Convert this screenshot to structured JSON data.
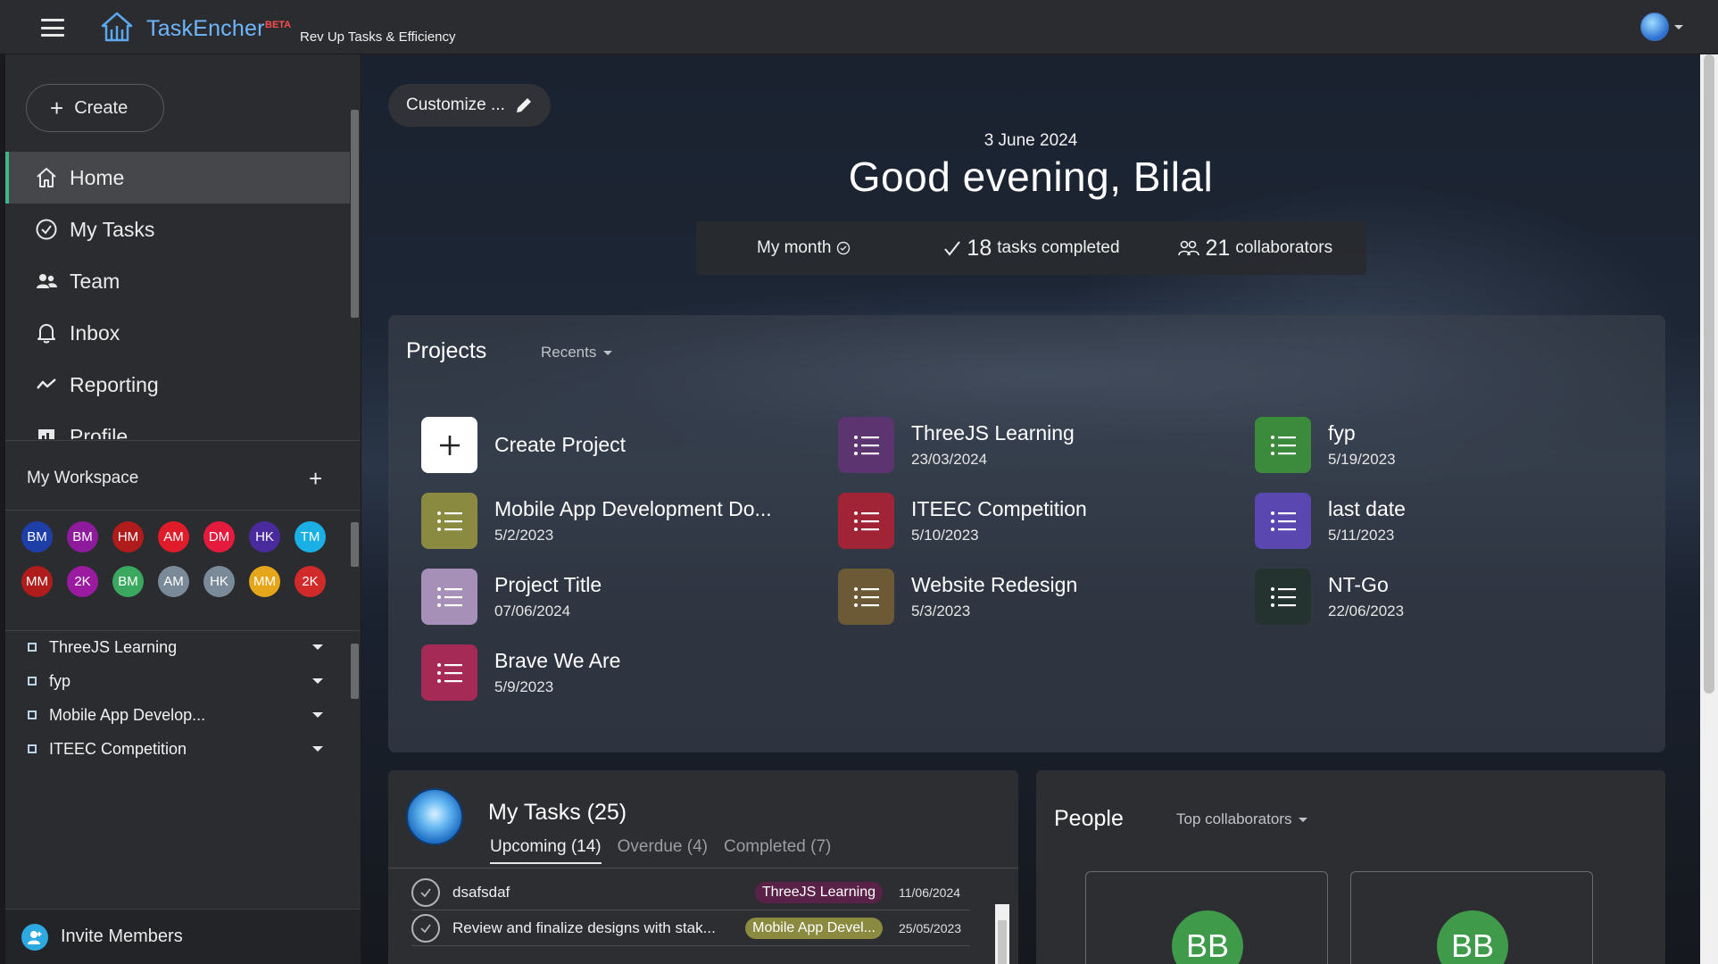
{
  "header": {
    "brand": "TaskEncher",
    "beta": "BETA",
    "tagline": "Rev Up Tasks & Efficiency"
  },
  "sidebar": {
    "create_label": "Create",
    "nav": [
      {
        "label": "Home",
        "icon": "home-icon",
        "active": true
      },
      {
        "label": "My Tasks",
        "icon": "check-circle-icon"
      },
      {
        "label": "Team",
        "icon": "team-icon"
      },
      {
        "label": "Inbox",
        "icon": "bell-icon"
      },
      {
        "label": "Reporting",
        "icon": "trend-icon"
      },
      {
        "label": "Profile",
        "icon": "profile-icon"
      }
    ],
    "workspace_title": "My Workspace",
    "members_row1": [
      {
        "initials": "BM",
        "color": "#1f3fa8"
      },
      {
        "initials": "BM",
        "color": "#8e1a9c"
      },
      {
        "initials": "HM",
        "color": "#b01c1c"
      },
      {
        "initials": "AM",
        "color": "#e01c2a"
      },
      {
        "initials": "DM",
        "color": "#e61a3c"
      },
      {
        "initials": "HK",
        "color": "#4a2b9e"
      },
      {
        "initials": "TM",
        "color": "#1ab0e6"
      }
    ],
    "members_row2": [
      {
        "initials": "MM",
        "color": "#b01c1c"
      },
      {
        "initials": "2K",
        "color": "#9a1aa0"
      },
      {
        "initials": "BM",
        "color": "#3ba860"
      },
      {
        "initials": "AM",
        "color": "#7a8a98"
      },
      {
        "initials": "HK",
        "color": "#7a8a98"
      },
      {
        "initials": "MM",
        "color": "#e6a61a"
      },
      {
        "initials": "2K",
        "color": "#d02a2a"
      }
    ],
    "projects": [
      "ThreeJS Learning",
      "fyp",
      "Mobile App Develop...",
      "ITEEC Competition"
    ],
    "invite_label": "Invite Members"
  },
  "main": {
    "customize_label": "Customize ...",
    "date": "3 June 2024",
    "greeting": "Good evening, Bilal",
    "stats": {
      "period": "My month",
      "tasks_completed_count": "18",
      "tasks_completed_label": "tasks completed",
      "collaborators_count": "21",
      "collaborators_label": "collaborators"
    },
    "projects_panel": {
      "title": "Projects",
      "filter": "Recents",
      "create_label": "Create Project",
      "items": [
        {
          "name": "ThreeJS Learning",
          "date": "23/03/2024",
          "color": "#5b3470"
        },
        {
          "name": "fyp",
          "date": "5/19/2023",
          "color": "#3c8a3c"
        },
        {
          "name": "Mobile App Development Do...",
          "date": "5/2/2023",
          "color": "#8a8a40"
        },
        {
          "name": "ITEEC Competition",
          "date": "5/10/2023",
          "color": "#a02435"
        },
        {
          "name": "last date",
          "date": "5/11/2023",
          "color": "#5a48b0"
        },
        {
          "name": "Project Title",
          "date": "07/06/2024",
          "color": "#a690b8"
        },
        {
          "name": "Website Redesign",
          "date": "5/3/2023",
          "color": "#6b5a35"
        },
        {
          "name": "NT-Go",
          "date": "22/06/2023",
          "color": "#243230"
        },
        {
          "name": "Brave We Are",
          "date": "5/9/2023",
          "color": "#a52a55"
        }
      ]
    },
    "tasks_panel": {
      "title": "My Tasks (25)",
      "tabs": [
        "Upcoming  (14)",
        "Overdue  (4)",
        "Completed  (7)"
      ],
      "rows": [
        {
          "name": "dsafsdaf",
          "tag": "ThreeJS Learning",
          "tag_color": "#5a2248",
          "date": "11/06/2024"
        },
        {
          "name": "Review and finalize designs with stak...",
          "tag": "Mobile App Devel...",
          "tag_color": "#8a8a40",
          "date": "25/05/2023"
        }
      ]
    },
    "people_panel": {
      "title": "People",
      "filter": "Top collaborators",
      "people": [
        {
          "initials": "BB"
        },
        {
          "initials": "BB"
        }
      ]
    }
  }
}
